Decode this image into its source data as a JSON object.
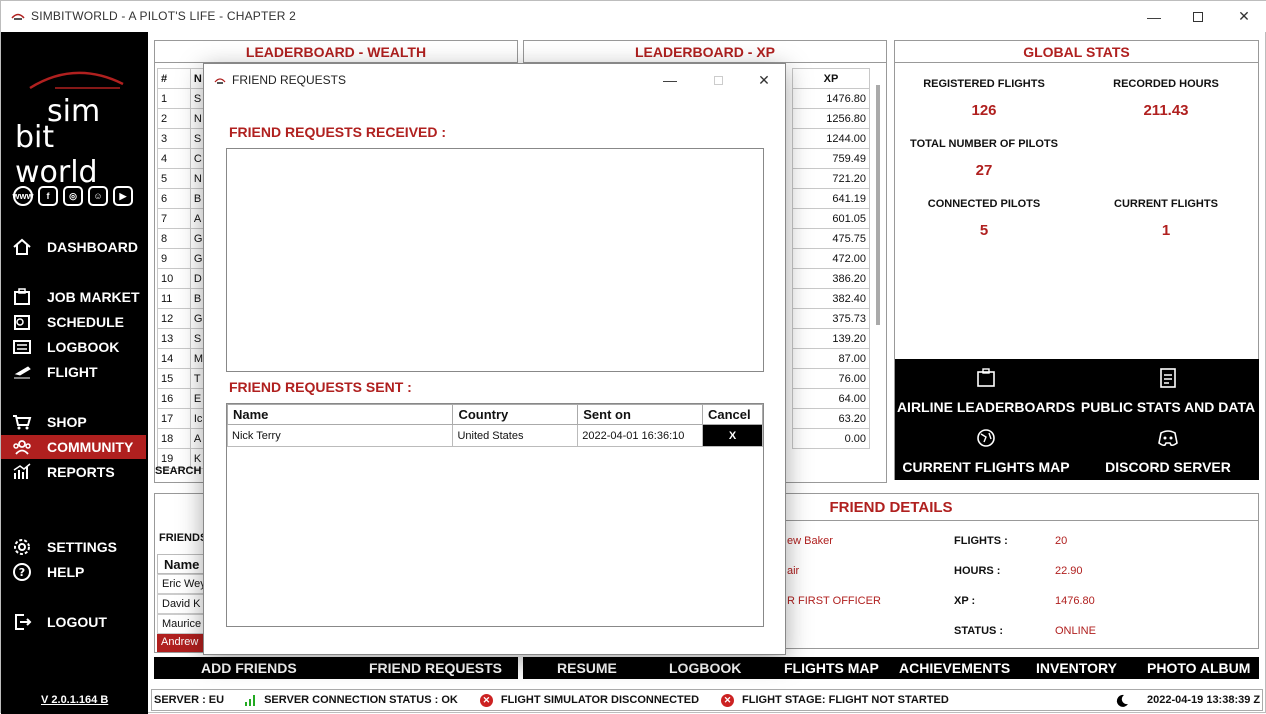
{
  "window": {
    "title": "SIMBITWORLD - A PILOT'S LIFE - CHAPTER 2"
  },
  "sidebar": {
    "logo_line1": "sim",
    "logo_line2": "bit world",
    "social": [
      "www",
      "f",
      "ig",
      "dc",
      "yt"
    ],
    "items": [
      {
        "label": "DASHBOARD",
        "icon": "home-icon"
      },
      {
        "label": "JOB MARKET",
        "icon": "clipboard-icon"
      },
      {
        "label": "SCHEDULE",
        "icon": "calendar-icon"
      },
      {
        "label": "LOGBOOK",
        "icon": "book-icon"
      },
      {
        "label": "FLIGHT",
        "icon": "plane-icon"
      },
      {
        "label": "SHOP",
        "icon": "cart-icon"
      },
      {
        "label": "COMMUNITY",
        "icon": "people-icon"
      },
      {
        "label": "REPORTS",
        "icon": "chart-icon"
      },
      {
        "label": "SETTINGS",
        "icon": "gear-icon"
      },
      {
        "label": "HELP",
        "icon": "help-icon"
      },
      {
        "label": "LOGOUT",
        "icon": "logout-icon"
      }
    ],
    "version": "V 2.0.1.164 B",
    "accent": "#b0201f"
  },
  "wealth": {
    "title": "LEADERBOARD - WEALTH",
    "col_rank": "#",
    "col_name": "N",
    "rows": [
      {
        "rank": "1",
        "name": "S"
      },
      {
        "rank": "2",
        "name": "N"
      },
      {
        "rank": "3",
        "name": "S"
      },
      {
        "rank": "4",
        "name": "C"
      },
      {
        "rank": "5",
        "name": "N"
      },
      {
        "rank": "6",
        "name": "B"
      },
      {
        "rank": "7",
        "name": "A"
      },
      {
        "rank": "8",
        "name": "G"
      },
      {
        "rank": "9",
        "name": "G"
      },
      {
        "rank": "10",
        "name": "D"
      },
      {
        "rank": "11",
        "name": "B"
      },
      {
        "rank": "12",
        "name": "G"
      },
      {
        "rank": "13",
        "name": "S"
      },
      {
        "rank": "14",
        "name": "M"
      },
      {
        "rank": "15",
        "name": "T"
      },
      {
        "rank": "16",
        "name": "E"
      },
      {
        "rank": "17",
        "name": "Ic"
      },
      {
        "rank": "18",
        "name": "A"
      },
      {
        "rank": "19",
        "name": "K"
      }
    ],
    "search_label": "SEARCH"
  },
  "xp": {
    "title": "LEADERBOARD - XP",
    "col_xp": "XP",
    "values": [
      "1476.80",
      "1256.80",
      "1244.00",
      "759.49",
      "721.20",
      "641.19",
      "601.05",
      "475.75",
      "472.00",
      "386.20",
      "382.40",
      "375.73",
      "139.20",
      "87.00",
      "76.00",
      "64.00",
      "63.20",
      "0.00"
    ]
  },
  "global": {
    "title": "GLOBAL STATS",
    "registered_flights_label": "REGISTERED FLIGHTS",
    "registered_flights": "126",
    "recorded_hours_label": "RECORDED HOURS",
    "recorded_hours": "211.43",
    "total_pilots_label": "TOTAL NUMBER OF PILOTS",
    "total_pilots": "27",
    "connected_pilots_label": "CONNECTED PILOTS",
    "connected_pilots": "5",
    "current_flights_label": "CURRENT FLIGHTS",
    "current_flights": "1",
    "links": {
      "airline_leaderboards": "AIRLINE LEADERBOARDS",
      "public_stats": "PUBLIC STATS AND DATA",
      "current_flights_map": "CURRENT FLIGHTS MAP",
      "discord_server": "DISCORD SERVER"
    }
  },
  "friends": {
    "friends_label": "FRIENDS",
    "col_name": "Name",
    "list": [
      "Eric Wey",
      "David K",
      "Maurice",
      "Andrew"
    ]
  },
  "friend_details": {
    "title": "FRIEND DETAILS",
    "name_partial": "ew Baker",
    "airline_partial": "air",
    "rank_partial": "R FIRST OFFICER",
    "flights_label": "FLIGHTS :",
    "flights": "20",
    "hours_label": "HOURS :",
    "hours": "22.90",
    "xp_label": "XP :",
    "xp": "1476.80",
    "status_label": "STATUS :",
    "status": "ONLINE"
  },
  "bottom_actions": {
    "add_friends": "ADD FRIENDS",
    "friend_requests": "FRIEND REQUESTS",
    "resume": "RESUME",
    "logbook": "LOGBOOK",
    "flights_map": "FLIGHTS MAP",
    "achievements": "ACHIEVEMENTS",
    "inventory": "INVENTORY",
    "photo_album": "PHOTO ALBUM"
  },
  "status_bar": {
    "server": "SERVER : EU",
    "connection": "SERVER CONNECTION STATUS : OK",
    "simulator": "FLIGHT SIMULATOR DISCONNECTED",
    "stage": "FLIGHT STAGE: FLIGHT NOT STARTED",
    "datetime": "2022-04-19 13:38:39 Z"
  },
  "modal": {
    "title": "FRIEND REQUESTS",
    "received_heading": "FRIEND REQUESTS RECEIVED :",
    "sent_heading": "FRIEND REQUESTS SENT :",
    "columns": {
      "name": "Name",
      "country": "Country",
      "sent_on": "Sent on",
      "cancel": "Cancel"
    },
    "sent": [
      {
        "name": "Nick Terry",
        "country": "United States",
        "sent_on": "2022-04-01 16:36:10",
        "cancel": "X"
      }
    ]
  }
}
